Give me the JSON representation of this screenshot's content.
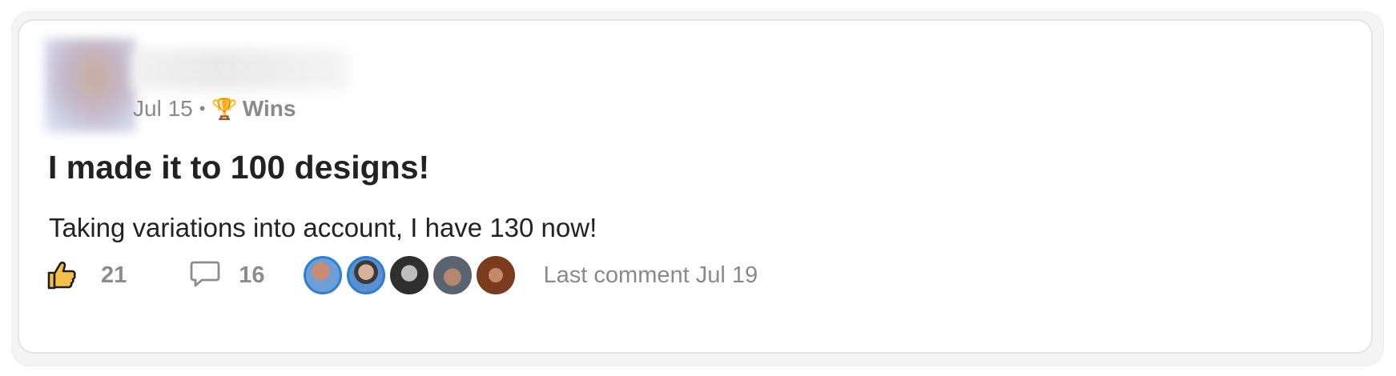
{
  "post": {
    "date": "Jul 15",
    "separator": "•",
    "category_icon": "trophy-icon",
    "category": "Wins",
    "title": "I made it to 100 designs!",
    "body": "Taking variations into account, I have 130 now!"
  },
  "footer": {
    "like_icon": "thumbs-up-icon",
    "like_count": "21",
    "comment_icon": "speech-bubble-icon",
    "comment_count": "16",
    "commenter_avatars": 5,
    "last_comment": "Last comment Jul 19"
  },
  "colors": {
    "title_text": "#222222",
    "muted_text": "#8a8a8a",
    "like_fill": "#f4c04a",
    "card_border": "#e3e3e3"
  }
}
